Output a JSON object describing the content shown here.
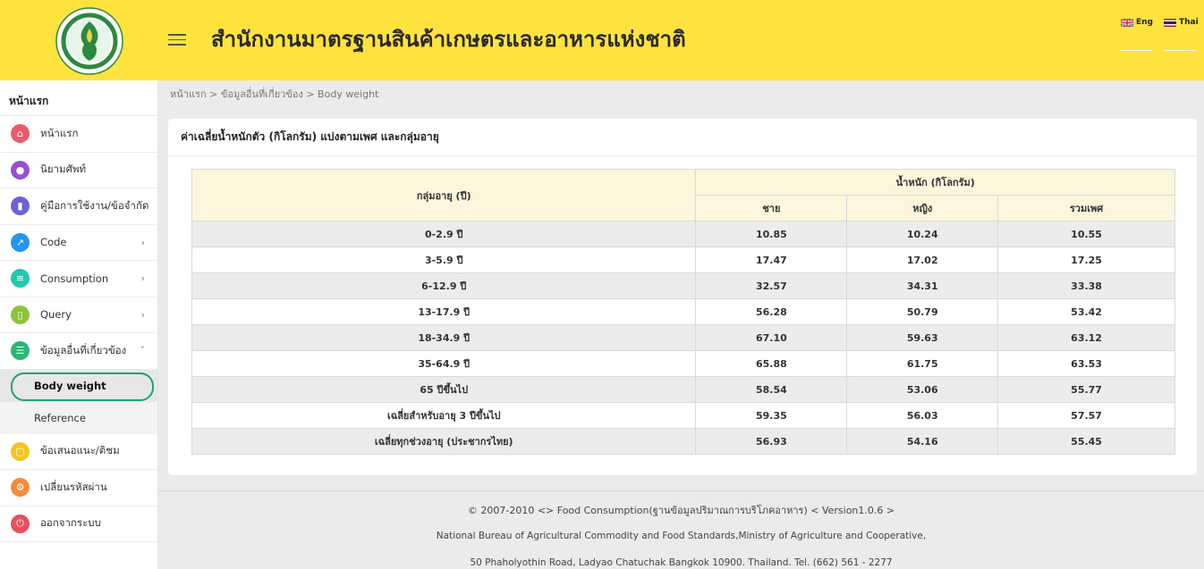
{
  "header": {
    "title": "สำนักงานมาตรฐานสินค้าเกษตรและอาหารแห่งชาติ",
    "lang_en": "Eng",
    "lang_th": "Thai",
    "bg_color": "#fee33f"
  },
  "sidebar": {
    "heading": "หน้าแรก",
    "items": [
      {
        "label": "หน้าแรก",
        "icon": "home-icon",
        "color": "#ea5b6b"
      },
      {
        "label": "นิยามศัพท์",
        "icon": "bulb-icon",
        "color": "#9b4fd4"
      },
      {
        "label": "คู่มือการใช้งาน/ข้อจำกัด",
        "icon": "book-icon",
        "color": "#6c62d8"
      },
      {
        "label": "Code",
        "icon": "wrench-icon",
        "color": "#2196f3"
      },
      {
        "label": "Consumption",
        "icon": "list-icon",
        "color": "#1ec9b0"
      },
      {
        "label": "Query",
        "icon": "file-icon",
        "color": "#8cc43a"
      },
      {
        "label": "ข้อมูลอื่นที่เกี่ยวข้อง",
        "icon": "database-icon",
        "color": "#2bb673"
      }
    ],
    "subitems": [
      {
        "label": "Body weight"
      },
      {
        "label": "Reference"
      }
    ],
    "bottom_items": [
      {
        "label": "ข้อเสนอแนะ/ติชม",
        "icon": "message-icon",
        "color": "#f3c623"
      },
      {
        "label": "เปลี่ยนรหัสผ่าน",
        "icon": "gear-icon",
        "color": "#f58c3a"
      },
      {
        "label": "ออกจากระบบ",
        "icon": "power-icon",
        "color": "#e8505b"
      }
    ]
  },
  "breadcrumb": {
    "text": "หน้าแรก > ข้อมูลอื่นที่เกี่ยวข้อง > Body weight"
  },
  "card": {
    "title": "ค่าเฉลี่ยน้ำหนักตัว (กิโลกรัม) แบ่งตามเพศ และกลุ่มอายุ"
  },
  "table": {
    "age_header": "กลุ่มอายุ (ปี)",
    "weight_header": "น้ำหนัก (กิโลกรัม)",
    "col_male": "ชาย",
    "col_female": "หญิง",
    "col_total": "รวมเพศ",
    "rows": [
      [
        "0-2.9 ปี",
        "10.85",
        "10.24",
        "10.55"
      ],
      [
        "3-5.9 ปี",
        "17.47",
        "17.02",
        "17.25"
      ],
      [
        "6-12.9 ปี",
        "32.57",
        "34.31",
        "33.38"
      ],
      [
        "13-17.9 ปี",
        "56.28",
        "50.79",
        "53.42"
      ],
      [
        "18-34.9 ปี",
        "67.10",
        "59.63",
        "63.12"
      ],
      [
        "35-64.9 ปี",
        "65.88",
        "61.75",
        "63.53"
      ],
      [
        "65 ปีขึ้นไป",
        "58.54",
        "53.06",
        "55.77"
      ],
      [
        "เฉลี่ยสำหรับอายุ 3 ปีขึ้นไป",
        "59.35",
        "56.03",
        "57.57"
      ],
      [
        "เฉลี่ยทุกช่วงอายุ (ประชากรไทย)",
        "56.93",
        "54.16",
        "55.45"
      ]
    ]
  },
  "footer": {
    "line1": "© 2007-2010 <> Food Consumption(ฐานข้อมูลปริมาณการบริโภคอาหาร) < Version1.0.6 >",
    "line2": "National Bureau of Agricultural Commodity and Food Standards,Ministry of Agriculture and Cooperative,",
    "line3": "50 Phaholyothin Road, Ladyao Chatuchak Bangkok 10900. Thailand. Tel. (662) 561 - 2277"
  }
}
